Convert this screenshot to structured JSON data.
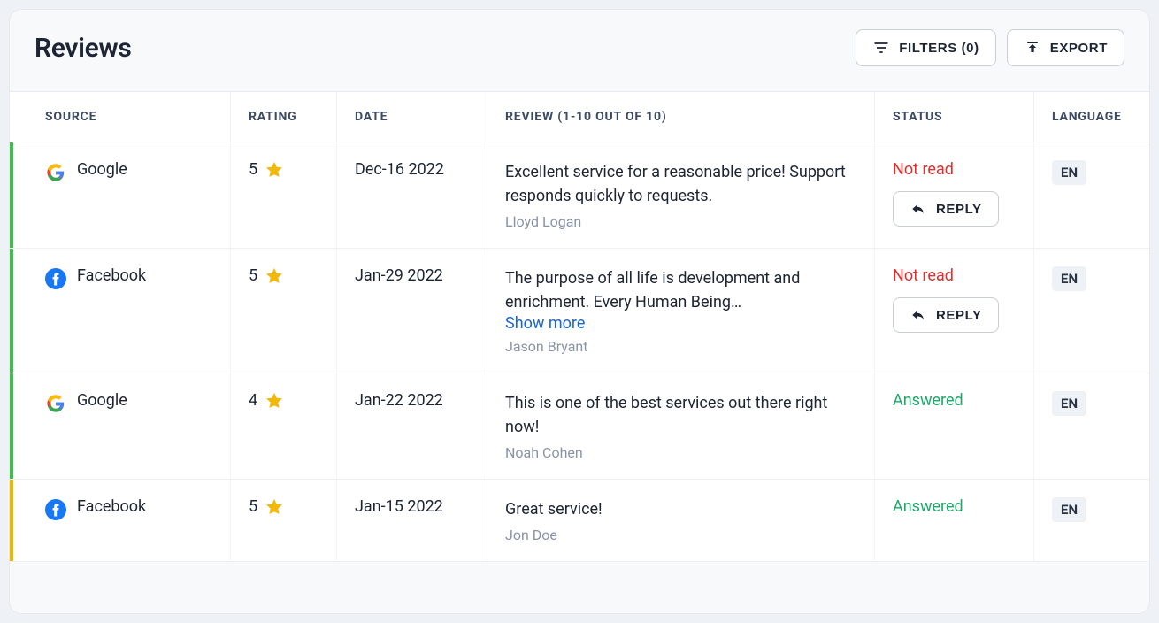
{
  "header": {
    "title": "Reviews",
    "filters_label": "FILTERS (0)",
    "export_label": "EXPORT"
  },
  "columns": {
    "source": "SOURCE",
    "rating": "RATING",
    "date": "DATE",
    "review": "REVIEW (1-10 OUT OF 10)",
    "status": "STATUS",
    "language": "LANGUAGE"
  },
  "statuses": {
    "not_read": "Not read",
    "answered": "Answered"
  },
  "actions": {
    "reply": "REPLY",
    "show_more": "Show more"
  },
  "rows": [
    {
      "source": "Google",
      "source_icon": "google",
      "rating": "5",
      "date": "Dec-16 2022",
      "review_text": "Excellent service for a reasonable price! Support responds quickly to requests.",
      "author": "Lloyd Logan",
      "status": "not_read",
      "language": "EN",
      "stripe": "green",
      "show_more": false
    },
    {
      "source": "Facebook",
      "source_icon": "facebook",
      "rating": "5",
      "date": "Jan-29 2022",
      "review_text": "The purpose of all life is development and enrichment. Every Human Being…",
      "author": "Jason Bryant",
      "status": "not_read",
      "language": "EN",
      "stripe": "green",
      "show_more": true
    },
    {
      "source": "Google",
      "source_icon": "google",
      "rating": "4",
      "date": "Jan-22 2022",
      "review_text": "This is one of the best services out there right now!",
      "author": "Noah Cohen",
      "status": "answered",
      "language": "EN",
      "stripe": "green",
      "show_more": false
    },
    {
      "source": "Facebook",
      "source_icon": "facebook",
      "rating": "5",
      "date": "Jan-15 2022",
      "review_text": "Great service!",
      "author": "Jon Doe",
      "status": "answered",
      "language": "EN",
      "stripe": "yellow",
      "show_more": false
    }
  ]
}
